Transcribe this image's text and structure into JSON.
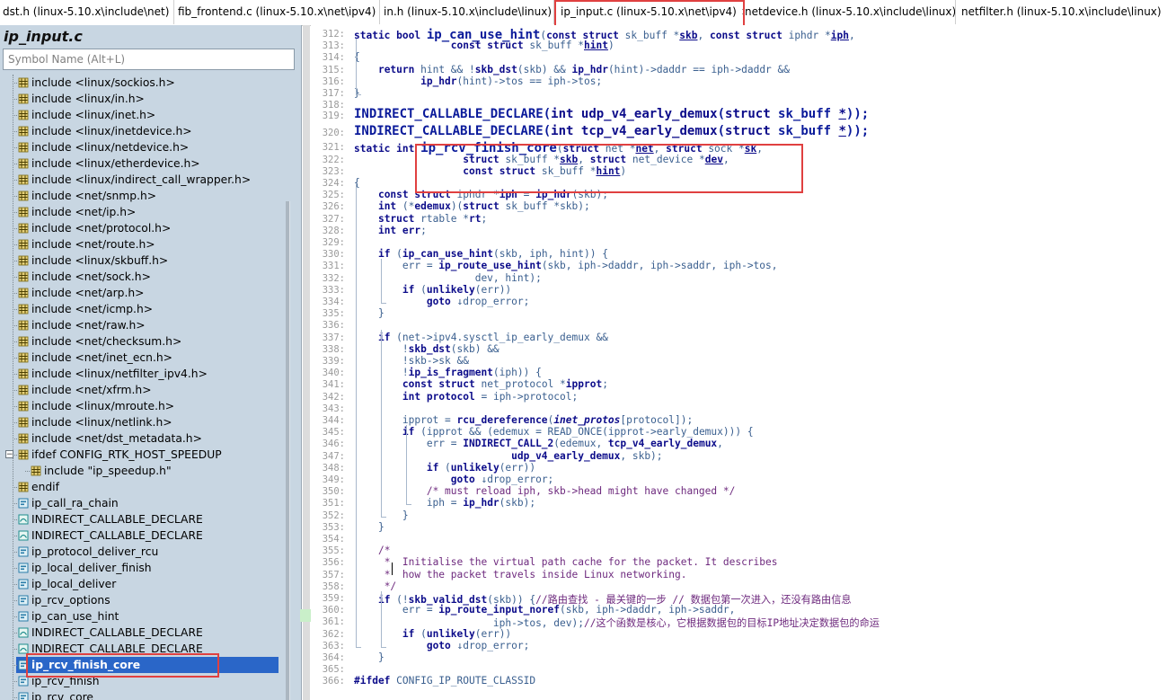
{
  "tabs": [
    {
      "label": "dst.h (linux-5.10.x\\include\\net)"
    },
    {
      "label": "fib_frontend.c (linux-5.10.x\\net\\ipv4)"
    },
    {
      "label": "in.h (linux-5.10.x\\include\\linux)"
    },
    {
      "label": "ip_input.c (linux-5.10.x\\net\\ipv4)",
      "active": true,
      "close": "✕"
    },
    {
      "label": "netdevice.h (linux-5.10.x\\include\\linux)"
    },
    {
      "label": "netfilter.h (linux-5.10.x\\include\\linux)"
    }
  ],
  "sidebar": {
    "title": "ip_input.c",
    "search_placeholder": "Symbol Name (Alt+L)",
    "items": [
      {
        "label": "include <linux/sockios.h>",
        "icon": "include-icon"
      },
      {
        "label": "include <linux/in.h>",
        "icon": "include-icon"
      },
      {
        "label": "include <linux/inet.h>",
        "icon": "include-icon"
      },
      {
        "label": "include <linux/inetdevice.h>",
        "icon": "include-icon"
      },
      {
        "label": "include <linux/netdevice.h>",
        "icon": "include-icon"
      },
      {
        "label": "include <linux/etherdevice.h>",
        "icon": "include-icon"
      },
      {
        "label": "include <linux/indirect_call_wrapper.h>",
        "icon": "include-icon"
      },
      {
        "label": "include <net/snmp.h>",
        "icon": "include-icon"
      },
      {
        "label": "include <net/ip.h>",
        "icon": "include-icon"
      },
      {
        "label": "include <net/protocol.h>",
        "icon": "include-icon"
      },
      {
        "label": "include <net/route.h>",
        "icon": "include-icon"
      },
      {
        "label": "include <linux/skbuff.h>",
        "icon": "include-icon"
      },
      {
        "label": "include <net/sock.h>",
        "icon": "include-icon"
      },
      {
        "label": "include <net/arp.h>",
        "icon": "include-icon"
      },
      {
        "label": "include <net/icmp.h>",
        "icon": "include-icon"
      },
      {
        "label": "include <net/raw.h>",
        "icon": "include-icon"
      },
      {
        "label": "include <net/checksum.h>",
        "icon": "include-icon"
      },
      {
        "label": "include <net/inet_ecn.h>",
        "icon": "include-icon"
      },
      {
        "label": "include <linux/netfilter_ipv4.h>",
        "icon": "include-icon"
      },
      {
        "label": "include <net/xfrm.h>",
        "icon": "include-icon"
      },
      {
        "label": "include <linux/mroute.h>",
        "icon": "include-icon"
      },
      {
        "label": "include <linux/netlink.h>",
        "icon": "include-icon"
      },
      {
        "label": "include <net/dst_metadata.h>",
        "icon": "include-icon"
      },
      {
        "label": "ifdef CONFIG_RTK_HOST_SPEEDUP",
        "icon": "include-icon"
      },
      {
        "label": "include \"ip_speedup.h\"",
        "icon": "include-icon"
      },
      {
        "label": "endif",
        "icon": "include-icon"
      },
      {
        "label": "ip_call_ra_chain",
        "icon": "function-icon"
      },
      {
        "label": "INDIRECT_CALLABLE_DECLARE",
        "icon": "declare-icon"
      },
      {
        "label": "INDIRECT_CALLABLE_DECLARE",
        "icon": "declare-icon"
      },
      {
        "label": "ip_protocol_deliver_rcu",
        "icon": "function-icon"
      },
      {
        "label": "ip_local_deliver_finish",
        "icon": "function-icon"
      },
      {
        "label": "ip_local_deliver",
        "icon": "function-icon"
      },
      {
        "label": "ip_rcv_options",
        "icon": "function-icon"
      },
      {
        "label": "ip_can_use_hint",
        "icon": "function-icon"
      },
      {
        "label": "INDIRECT_CALLABLE_DECLARE",
        "icon": "declare-icon"
      },
      {
        "label": "INDIRECT_CALLABLE_DECLARE",
        "icon": "declare-icon"
      },
      {
        "label": "ip_rcv_finish_core",
        "icon": "function-icon",
        "selected": true
      },
      {
        "label": "ip_rcv_finish",
        "icon": "function-icon"
      },
      {
        "label": "ip_rcv_core",
        "icon": "function-icon"
      }
    ]
  },
  "code": {
    "lines": [
      {
        "n": "312:",
        "html": "<span class='k'>static</span> <span class='k'>bool</span> <span class='fn'>ip_can_use_hint</span>(<span class='k'>const</span> <span class='k'>struct</span> sk_buff *<span class='u'>skb</span>, <span class='k'>const</span> <span class='k'>struct</span> iphdr *<span class='u'>iph</span>,"
      },
      {
        "n": "313:",
        "html": "                <span class='k'>const</span> <span class='k'>struct</span> sk_buff *<span class='u'>hint</span>)"
      },
      {
        "n": "314:",
        "html": "{"
      },
      {
        "n": "315:",
        "html": "    <span class='k'>return</span> hint &amp;&amp; !<span class='f'>skb_dst</span>(skb) &amp;&amp; <span class='f'>ip_hdr</span>(hint)-&gt;daddr == iph-&gt;daddr &amp;&amp;"
      },
      {
        "n": "316:",
        "html": "           <span class='f'>ip_hdr</span>(hint)-&gt;tos == iph-&gt;tos;"
      },
      {
        "n": "317:",
        "html": "}"
      },
      {
        "n": "318:",
        "html": ""
      },
      {
        "n": "319:",
        "html": "<span class='fn'>INDIRECT_CALLABLE_DECLARE</span>(<span class='k'>int</span> <span class='f'>udp_v4_early_demux</span>(<span class='k'>struct</span> sk_buff <span class='u'>*</span>));",
        "big": true
      },
      {
        "n": "320:",
        "html": "<span class='fn'>INDIRECT_CALLABLE_DECLARE</span>(<span class='k'>int</span> <span class='f'>tcp_v4_early_demux</span>(<span class='k'>struct</span> sk_buff <span class='u'>*</span>));",
        "big": true
      },
      {
        "n": "321:",
        "html": "<span class='k'>static</span> <span class='k'>int</span> <span class='fn'>ip_rcv_finish_core</span>(<span class='k'>struct</span> net *<span class='u'>net</span>, <span class='k'>struct</span> sock *<span class='u'>sk</span>,"
      },
      {
        "n": "322:",
        "html": "                  <span class='k'>struct</span> sk_buff *<span class='u'>skb</span>, <span class='k'>struct</span> net_device *<span class='u'>dev</span>,"
      },
      {
        "n": "323:",
        "html": "                  <span class='k'>const</span> <span class='k'>struct</span> sk_buff *<span class='u'>hint</span>)"
      },
      {
        "n": "324:",
        "html": "{"
      },
      {
        "n": "325:",
        "html": "    <span class='k'>const</span> <span class='k'>struct</span> iphdr *<span class='k'>iph</span> = <span class='f'>ip_hdr</span>(skb);"
      },
      {
        "n": "326:",
        "html": "    <span class='k'>int</span> (*<span class='k'>edemux</span>)(<span class='k'>struct</span> sk_buff *skb);"
      },
      {
        "n": "327:",
        "html": "    <span class='k'>struct</span> rtable *<span class='k'>rt</span>;"
      },
      {
        "n": "328:",
        "html": "    <span class='k'>int</span> <span class='k'>err</span>;"
      },
      {
        "n": "329:",
        "html": ""
      },
      {
        "n": "330:",
        "html": "    <span class='k'>if</span> (<span class='f'>ip_can_use_hint</span>(skb, iph, hint)) {"
      },
      {
        "n": "331:",
        "html": "        err = <span class='f'>ip_route_use_hint</span>(skb, iph-&gt;daddr, iph-&gt;saddr, iph-&gt;tos,"
      },
      {
        "n": "332:",
        "html": "                    dev, hint);"
      },
      {
        "n": "333:",
        "html": "        <span class='k'>if</span> (<span class='f'>unlikely</span>(err))"
      },
      {
        "n": "334:",
        "html": "            <span class='k'>goto</span> ↓drop_error;"
      },
      {
        "n": "335:",
        "html": "    }"
      },
      {
        "n": "336:",
        "html": ""
      },
      {
        "n": "337:",
        "html": "    <span class='k'>if</span> (net-&gt;ipv4.sysctl_ip_early_demux &amp;&amp;"
      },
      {
        "n": "338:",
        "html": "        !<span class='f'>skb_dst</span>(skb) &amp;&amp;"
      },
      {
        "n": "339:",
        "html": "        !skb-&gt;sk &amp;&amp;"
      },
      {
        "n": "340:",
        "html": "        !<span class='f'>ip_is_fragment</span>(iph)) {"
      },
      {
        "n": "341:",
        "html": "        <span class='k'>const</span> <span class='k'>struct</span> net_protocol *<span class='k'>ipprot</span>;"
      },
      {
        "n": "342:",
        "html": "        <span class='k'>int</span> <span class='k'>protocol</span> = iph-&gt;protocol;"
      },
      {
        "n": "343:",
        "html": ""
      },
      {
        "n": "344:",
        "html": "        ipprot = <span class='f'>rcu_dereference</span>(<span class='it'>inet_protos</span>[protocol]);"
      },
      {
        "n": "345:",
        "html": "        <span class='k'>if</span> (ipprot &amp;&amp; (edemux = READ_ONCE(ipprot-&gt;early_demux))) {"
      },
      {
        "n": "346:",
        "html": "            err = <span class='f'>INDIRECT_CALL_2</span>(edemux, <span class='f'>tcp_v4_early_demux</span>,"
      },
      {
        "n": "347:",
        "html": "                          <span class='f'>udp_v4_early_demux</span>, skb);"
      },
      {
        "n": "348:",
        "html": "            <span class='k'>if</span> (<span class='f'>unlikely</span>(err))"
      },
      {
        "n": "349:",
        "html": "                <span class='k'>goto</span> ↓drop_error;"
      },
      {
        "n": "350:",
        "html": "            <span class='c'>/* must reload iph, skb-&gt;head might have changed */</span>"
      },
      {
        "n": "351:",
        "html": "            iph = <span class='f'>ip_hdr</span>(skb);"
      },
      {
        "n": "352:",
        "html": "        }"
      },
      {
        "n": "353:",
        "html": "    }"
      },
      {
        "n": "354:",
        "html": ""
      },
      {
        "n": "355:",
        "html": "    <span class='c'>/*</span>"
      },
      {
        "n": "356:",
        "html": "    <span class='c'> *  Initialise the virtual path cache for the packet. It describes</span>"
      },
      {
        "n": "357:",
        "html": "    <span class='c'> *  how the packet travels inside Linux networking.</span>"
      },
      {
        "n": "358:",
        "html": "    <span class='c'> */</span>"
      },
      {
        "n": "359:",
        "html": "    <span class='k'>if</span> (!<span class='f'>skb_valid_dst</span>(skb)) {<span class='c'>//路由查找 - 最关键的一步 // 数据包第一次进入，还没有路由信息</span>"
      },
      {
        "n": "360:",
        "html": "        err = <span class='f'>ip_route_input_noref</span>(skb, iph-&gt;daddr, iph-&gt;saddr,"
      },
      {
        "n": "361:",
        "html": "                       iph-&gt;tos, dev);<span class='c'>//这个函数是核心，它根据数据包的目标IP地址决定数据包的命运</span>"
      },
      {
        "n": "362:",
        "html": "        <span class='k'>if</span> (<span class='f'>unlikely</span>(err))"
      },
      {
        "n": "363:",
        "html": "            <span class='k'>goto</span> ↓drop_error;"
      },
      {
        "n": "364:",
        "html": "    }"
      },
      {
        "n": "365:",
        "html": ""
      },
      {
        "n": "366:",
        "html": "<span class='k'>#ifdef</span> CONFIG_IP_ROUTE_CLASSID"
      }
    ]
  },
  "colors": {
    "selection": "#2a66c8",
    "highlight_box": "#e04040",
    "sidebar_bg": "#c8d6e2"
  }
}
